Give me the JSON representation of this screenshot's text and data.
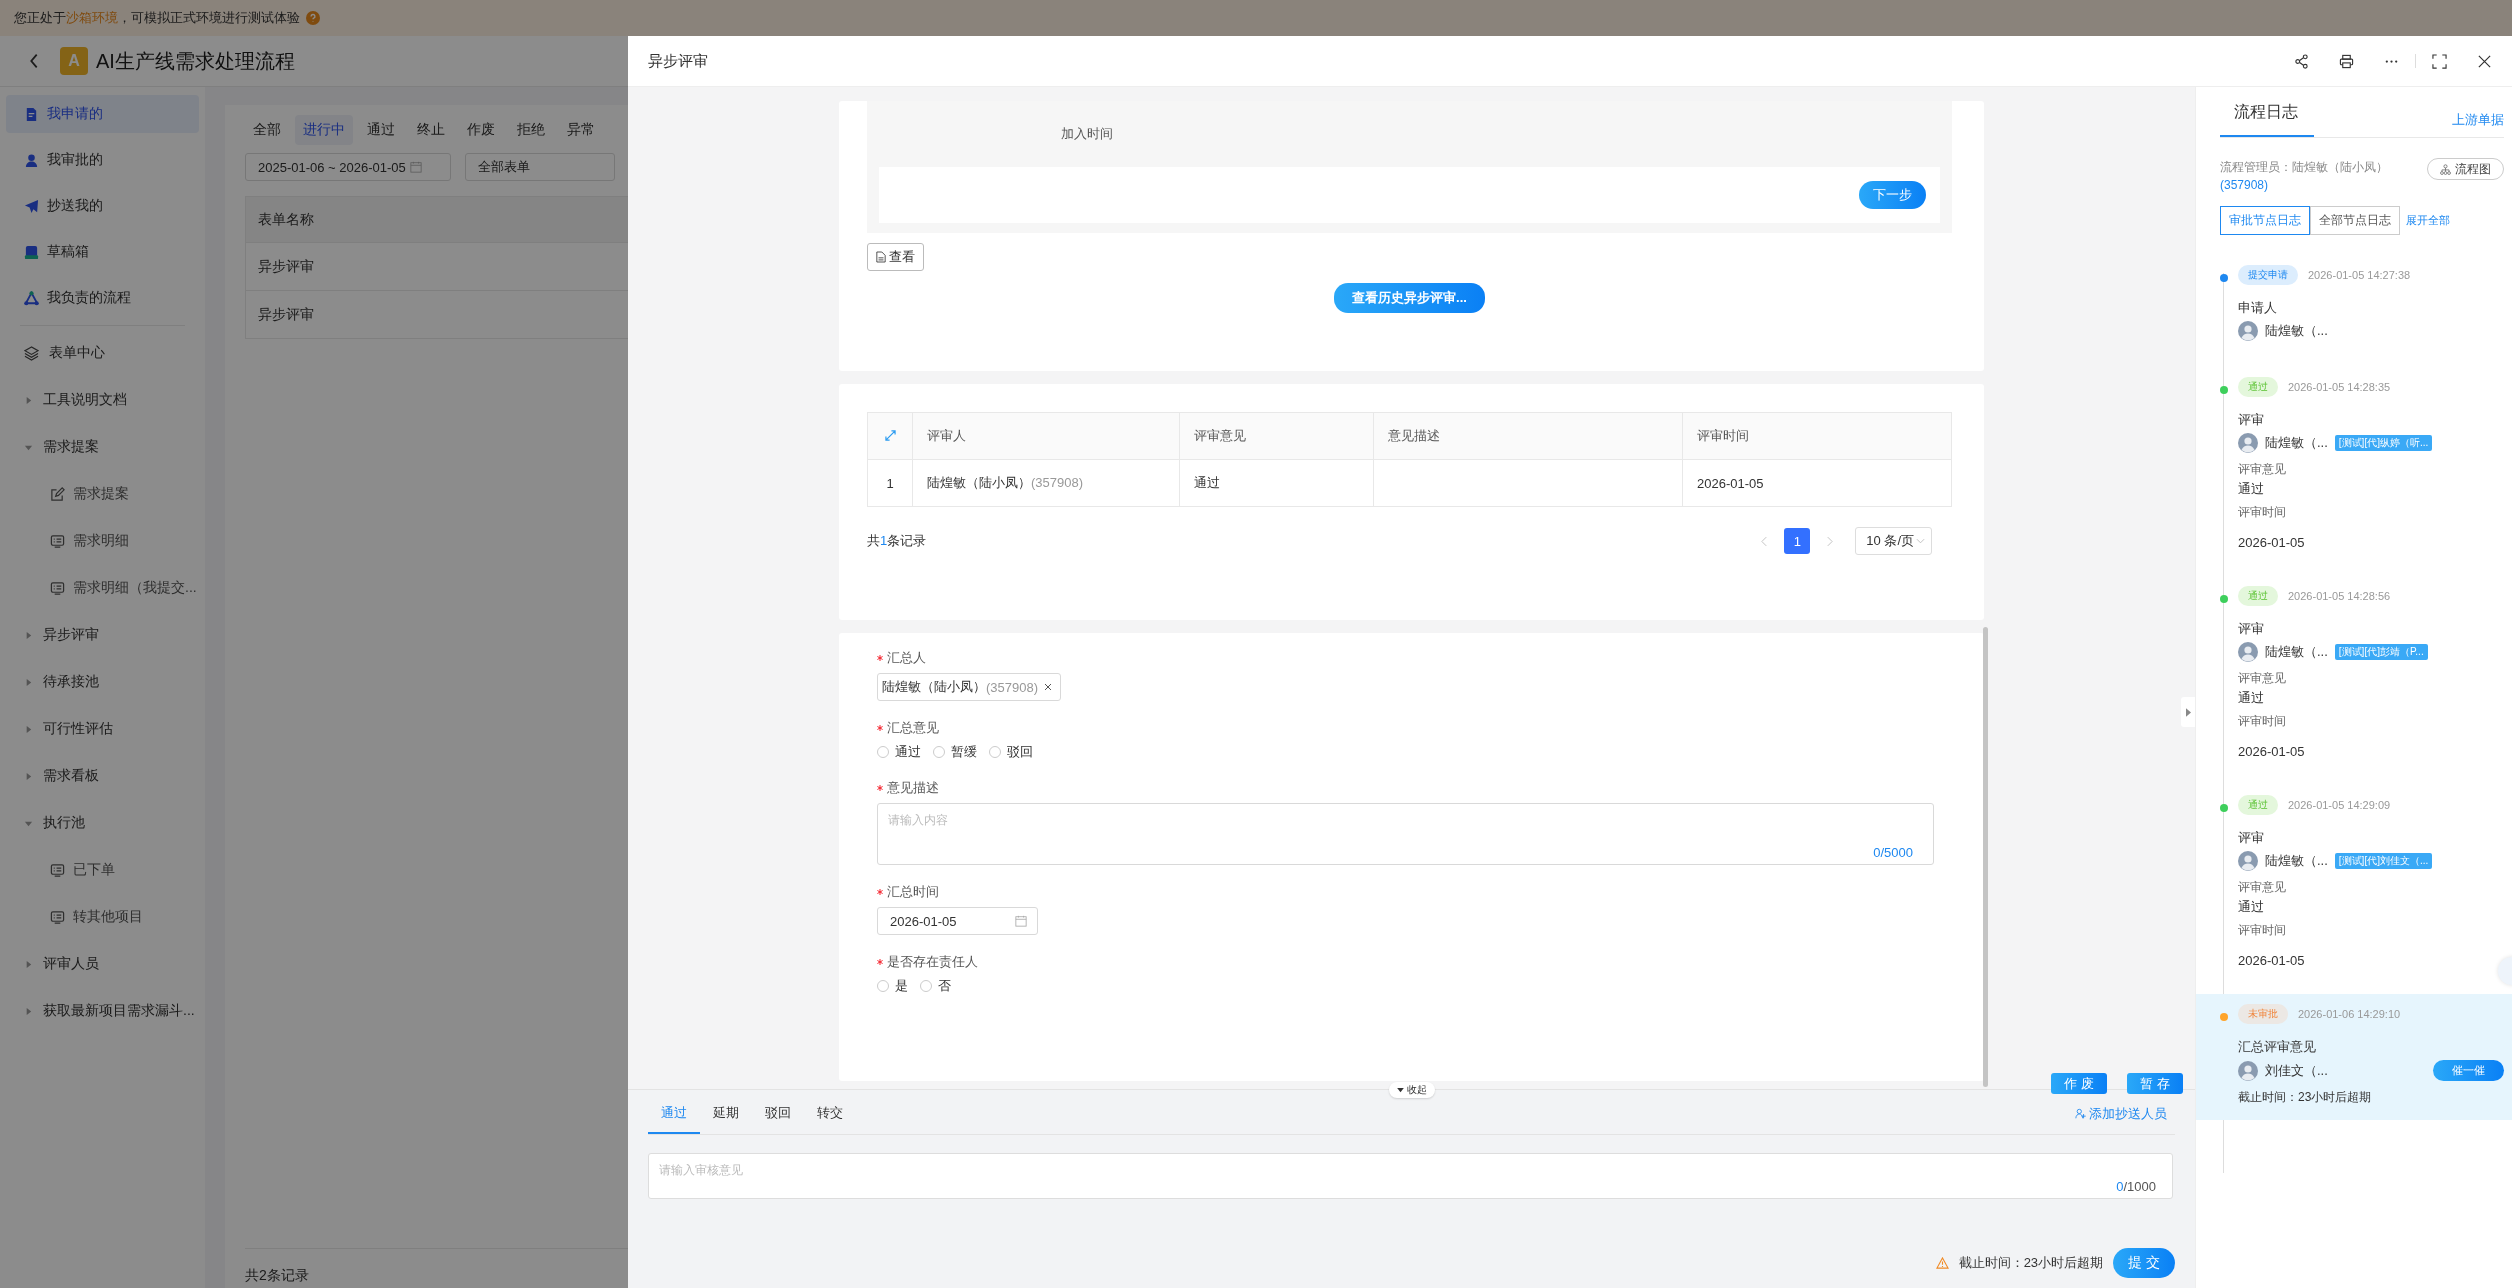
{
  "banner": {
    "before": "您正处于",
    "highlight": "沙箱环境",
    "after": "，可模拟正式环境进行测试体验"
  },
  "app": {
    "logo_letter": "A",
    "title": "AI生产线需求处理流程"
  },
  "nav": [
    {
      "label": "我申请的",
      "selected": true
    },
    {
      "label": "我审批的",
      "selected": false
    },
    {
      "label": "抄送我的",
      "selected": false
    },
    {
      "label": "草稿箱",
      "selected": false
    },
    {
      "label": "我负责的流程",
      "selected": false
    }
  ],
  "menu": [
    {
      "kind": "section",
      "label": "表单中心"
    },
    {
      "kind": "group",
      "label": "工具说明文档",
      "expanded": false
    },
    {
      "kind": "group",
      "label": "需求提案",
      "expanded": true,
      "children": [
        {
          "label": "需求提案",
          "kind": "edit"
        },
        {
          "label": "需求明细",
          "kind": "list"
        },
        {
          "label": "需求明细（我提交...",
          "kind": "list"
        }
      ]
    },
    {
      "kind": "group",
      "label": "异步评审",
      "expanded": false
    },
    {
      "kind": "group",
      "label": "待承接池",
      "expanded": false
    },
    {
      "kind": "group",
      "label": "可行性评估",
      "expanded": false
    },
    {
      "kind": "group",
      "label": "需求看板",
      "expanded": false
    },
    {
      "kind": "group",
      "label": "执行池",
      "expanded": true,
      "children": [
        {
          "label": "已下单",
          "kind": "list"
        },
        {
          "label": "转其他项目",
          "kind": "list"
        }
      ]
    },
    {
      "kind": "group",
      "label": "评审人员",
      "expanded": false
    },
    {
      "kind": "group",
      "label": "获取最新项目需求漏斗...",
      "expanded": false
    }
  ],
  "list": {
    "filters": [
      {
        "label": "全部",
        "selected": false
      },
      {
        "label": "进行中",
        "selected": true
      },
      {
        "label": "通过",
        "selected": false
      },
      {
        "label": "终止",
        "selected": false
      },
      {
        "label": "作废",
        "selected": false
      },
      {
        "label": "拒绝",
        "selected": false
      },
      {
        "label": "异常",
        "selected": false
      }
    ],
    "date_range": "2025-01-06 ~ 2026-01-05",
    "form_select": "全部表单",
    "column": "表单名称",
    "rows": [
      "异步评审",
      "异步评审"
    ],
    "footer": "共2条记录"
  },
  "modal": {
    "title": "异步评审",
    "step_panel": {
      "column": "加入时间",
      "next_button": "下一步"
    },
    "view_button": "查看",
    "history_button": "查看历史异步评审...",
    "review_table": {
      "columns": [
        "评审人",
        "评审意见",
        "意见描述",
        "评审时间"
      ],
      "rows": [
        {
          "index": "1",
          "reviewer": "陆煌敏（陆小凤）",
          "reviewer_id": "(357908)",
          "opinion": "通过",
          "time": "2026-01-05"
        }
      ],
      "total": {
        "before": "共",
        "count": "1",
        "after": "条记录"
      },
      "pages": [
        {
          "label": "1",
          "selected": true
        }
      ],
      "page_size": "10 条/页"
    },
    "form": [
      {
        "kind": "tag",
        "label": "汇总人",
        "required": true,
        "tag": "陆煌敏（陆小凤）",
        "tag_id": "(357908)"
      },
      {
        "kind": "radio",
        "label": "汇总意见",
        "required": true,
        "options": [
          {
            "label": "通过",
            "selected": false
          },
          {
            "label": "暂缓",
            "selected": false
          },
          {
            "label": "驳回",
            "selected": false
          }
        ]
      },
      {
        "kind": "textarea",
        "label": "意见描述",
        "required": true,
        "placeholder": "请输入内容",
        "counter": "0/5000"
      },
      {
        "kind": "date",
        "label": "汇总时间",
        "required": true,
        "value": "2026-01-05"
      },
      {
        "kind": "radio",
        "label": "是否存在责任人",
        "required": true,
        "options": [
          {
            "label": "是",
            "selected": false
          },
          {
            "label": "否",
            "selected": false
          }
        ]
      }
    ],
    "float_buttons": [
      "作 废",
      "暂 存"
    ],
    "collapse": "收起",
    "action_tabs": [
      {
        "label": "通过",
        "selected": true
      },
      {
        "label": "延期",
        "selected": false
      },
      {
        "label": "驳回",
        "selected": false
      },
      {
        "label": "转交",
        "selected": false
      }
    ],
    "cc_link": "添加抄送人员",
    "comment": {
      "placeholder": "请输入审核意见",
      "count": "0",
      "limit": "/1000"
    },
    "deadline": "截止时间：23小时后超期",
    "submit": "提 交"
  },
  "log": {
    "tab": "流程日志",
    "upstream_link": "上游单据",
    "manager": "流程管理员：陆煌敏（陆小凤）",
    "manager_id": "(357908)",
    "flowchart_button": "流程图",
    "log_tabs": [
      {
        "label": "审批节点日志",
        "selected": true
      },
      {
        "label": "全部节点日志",
        "selected": false
      }
    ],
    "expand_all": "展开全部",
    "entries": [
      {
        "kind": "submitted",
        "status": "提交申请",
        "time": "2026-01-05 14:27:38",
        "node": "申请人",
        "person": "陆煌敏（..."
      },
      {
        "kind": "passed",
        "status": "通过",
        "time": "2026-01-05 14:28:35",
        "node": "评审",
        "person": "陆煌敏（...",
        "delegate": "[测试][代]纵婷（听...",
        "fields": [
          {
            "label": "评审意见",
            "value": "通过"
          },
          {
            "label": "评审时间",
            "value": "2026-01-05"
          }
        ]
      },
      {
        "kind": "passed",
        "status": "通过",
        "time": "2026-01-05 14:28:56",
        "node": "评审",
        "person": "陆煌敏（...",
        "delegate": "[测试][代]彭靖（P...",
        "fields": [
          {
            "label": "评审意见",
            "value": "通过"
          },
          {
            "label": "评审时间",
            "value": "2026-01-05"
          }
        ]
      },
      {
        "kind": "passed",
        "status": "通过",
        "time": "2026-01-05 14:29:09",
        "node": "评审",
        "person": "陆煌敏（...",
        "delegate": "[测试][代]刘佳文（...",
        "fields": [
          {
            "label": "评审意见",
            "value": "通过"
          },
          {
            "label": "评审时间",
            "value": "2026-01-05"
          }
        ]
      },
      {
        "kind": "pending",
        "status": "未审批",
        "time": "2026-01-06 14:29:10",
        "node": "汇总评审意见",
        "person": "刘佳文（...",
        "urge_button": "催一催",
        "deadline": "截止时间：23小时后超期"
      }
    ]
  }
}
